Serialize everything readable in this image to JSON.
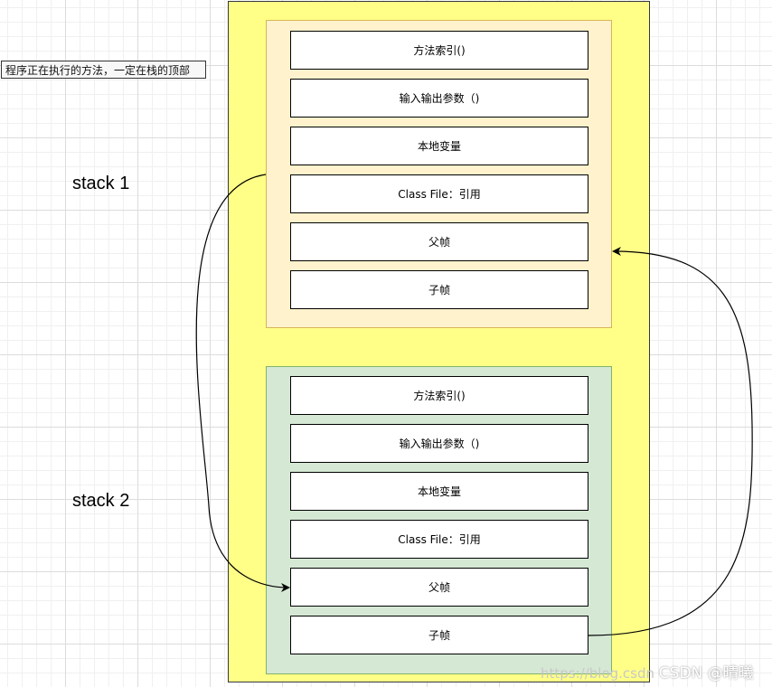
{
  "note": "程序正在执行的方法，一定在栈的顶部",
  "stacks": [
    {
      "label": "stack 1",
      "cells": [
        "方法索引()",
        "输入输出参数（)",
        "本地变量",
        "Class File：引用",
        "父帧",
        "子帧"
      ]
    },
    {
      "label": "stack 2",
      "cells": [
        "方法索引()",
        "输入输出参数（)",
        "本地变量",
        "Class File：引用",
        "父帧",
        "子帧"
      ]
    }
  ],
  "watermark": {
    "url": "https://blog.csdn",
    "brand": "CSDN @晴曦"
  },
  "colors": {
    "outer_fill": "#ffff88",
    "frame1_fill": "#fff2cc",
    "frame2_fill": "#d5e8d4"
  }
}
